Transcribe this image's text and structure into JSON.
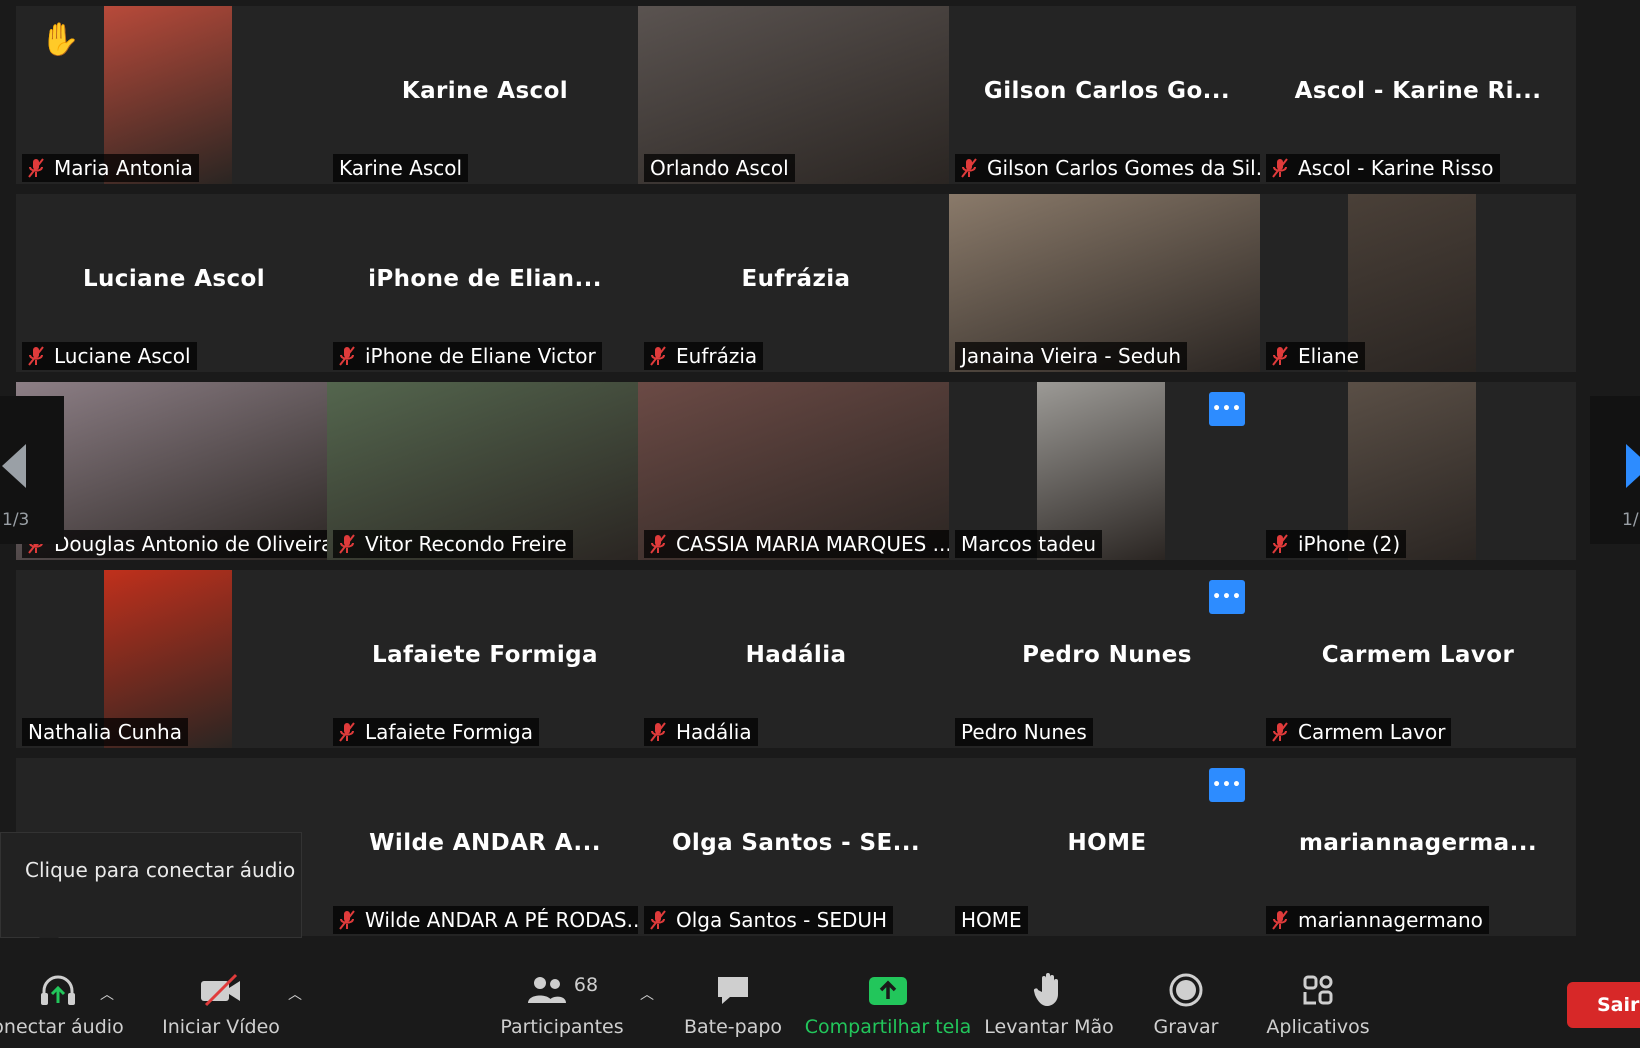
{
  "tiles": [
    {
      "display": "",
      "label": "Maria Antonia",
      "muted": true,
      "raised": true,
      "video": "#b84a3a"
    },
    {
      "display": "Karine Ascol",
      "label": "Karine Ascol",
      "muted": false
    },
    {
      "display": "",
      "label": "Orlando Ascol",
      "muted": false,
      "video": "#5a5350"
    },
    {
      "display": "Gilson Carlos Go...",
      "label": "Gilson Carlos Gomes da Sil...",
      "muted": true
    },
    {
      "display": "Ascol - Karine Ri...",
      "label": "Ascol - Karine Risso",
      "muted": true
    },
    {
      "display": "Luciane Ascol",
      "label": "Luciane Ascol",
      "muted": true
    },
    {
      "display": "iPhone de Elian...",
      "label": "iPhone de Eliane Victor",
      "muted": true
    },
    {
      "display": "Eufrázia",
      "label": "Eufrázia",
      "muted": true
    },
    {
      "display": "",
      "label": "Janaina Vieira - Seduh",
      "muted": false,
      "active": true,
      "video": "#8a7a6a"
    },
    {
      "display": "",
      "label": "Eliane",
      "muted": true,
      "video": "#4a4038"
    },
    {
      "display": "",
      "label": "Douglas Antonio de Oliveira",
      "muted": true,
      "video": "#8d7f86"
    },
    {
      "display": "",
      "label": "Vitor Recondo Freire",
      "muted": true,
      "video": "#54664e"
    },
    {
      "display": "",
      "label": "CASSIA MARIA MARQUES ...",
      "muted": true,
      "video": "#6b4a45"
    },
    {
      "display": "",
      "label": "Marcos tadeu",
      "muted": false,
      "more": true,
      "video": "#9c9a96"
    },
    {
      "display": "",
      "label": "iPhone (2)",
      "muted": true,
      "video": "#5a4f46"
    },
    {
      "display": "",
      "label": "Nathalia Cunha",
      "muted": false,
      "video": "#c0301c"
    },
    {
      "display": "Lafaiete Formiga",
      "label": "Lafaiete Formiga",
      "muted": true
    },
    {
      "display": "Hadália",
      "label": "Hadália",
      "muted": true
    },
    {
      "display": "Pedro Nunes",
      "label": "Pedro Nunes",
      "muted": false,
      "more": true
    },
    {
      "display": "Carmem Lavor",
      "label": "Carmem Lavor",
      "muted": true
    },
    {
      "display": "",
      "label": "",
      "muted": false
    },
    {
      "display": "Wilde ANDAR A...",
      "label": "Wilde ANDAR A PÉ RODAS...",
      "muted": true
    },
    {
      "display": "Olga Santos - SE...",
      "label": "Olga Santos - SEDUH",
      "muted": true
    },
    {
      "display": "HOME",
      "label": "HOME",
      "muted": false,
      "more": true
    },
    {
      "display": "mariannagerma...",
      "label": "mariannagermano",
      "muted": true
    }
  ],
  "pager": {
    "left_label": "1/3",
    "right_label": "1/"
  },
  "tooltip": {
    "text": "Clique para conectar áudio"
  },
  "toolbar": {
    "audio": "onectar áudio",
    "video": "Iniciar Vídeo",
    "participants": "Participantes",
    "participants_count": "68",
    "chat": "Bate-papo",
    "share": "Compartilhar tela",
    "raise": "Levantar Mão",
    "record": "Gravar",
    "apps": "Aplicativos",
    "leave": "Sair"
  },
  "colors": {
    "accent": "#2d8cff",
    "share_green": "#22c65b",
    "active_border": "#c6e04a",
    "leave_red": "#d72828",
    "mute_red": "#e03b3b"
  }
}
